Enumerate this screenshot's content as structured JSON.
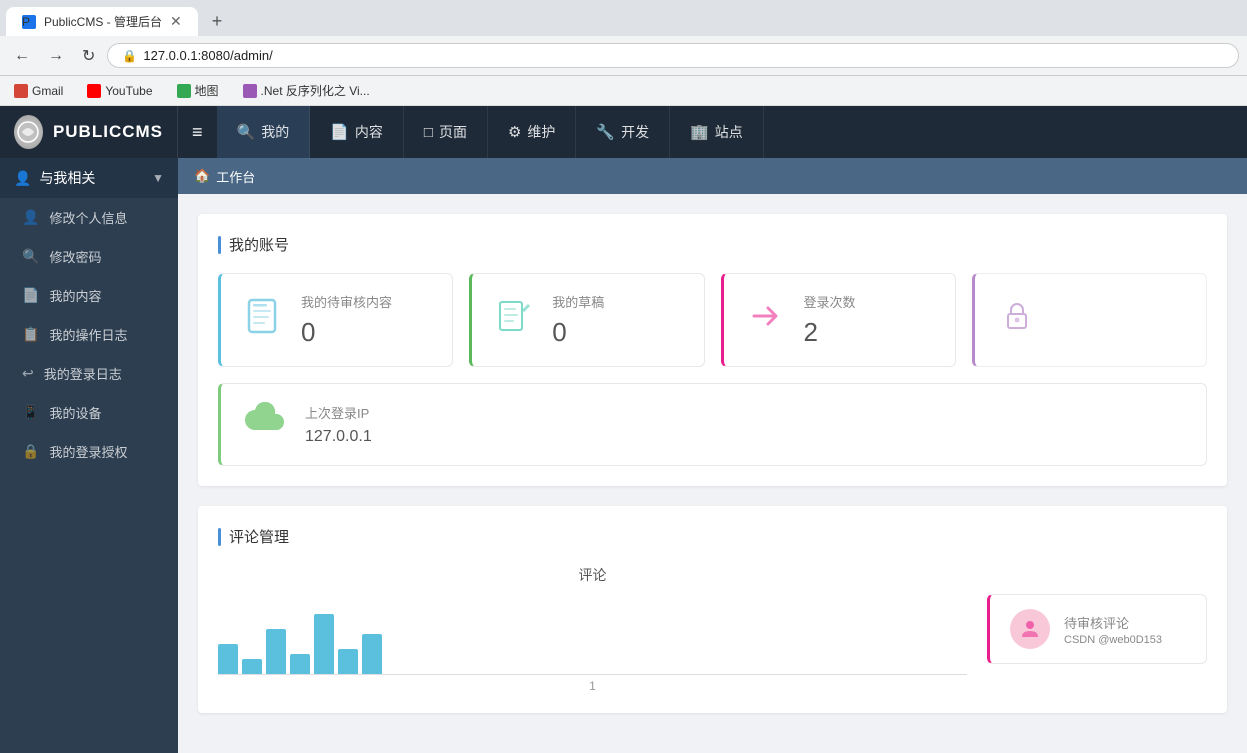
{
  "browser": {
    "tab": {
      "title": "PublicCMS - 管理后台",
      "favicon": "P"
    },
    "address": "127.0.0.1:8080/admin/",
    "protocol_icon": "🔒",
    "new_tab_label": "+",
    "bookmarks": [
      {
        "id": "gmail",
        "label": "Gmail",
        "favicon_class": "gmail-favicon"
      },
      {
        "id": "youtube",
        "label": "YouTube",
        "favicon_class": "youtube-favicon"
      },
      {
        "id": "maps",
        "label": "地图",
        "favicon_class": "maps-favicon"
      },
      {
        "id": "dotnet",
        "label": ".Net 反序列化之 Vi...",
        "favicon_class": "dotnet-favicon"
      }
    ],
    "nav_back": "←",
    "nav_forward": "→",
    "nav_refresh": "↻"
  },
  "app": {
    "logo_text": "PUBLICCMS",
    "hamburger": "≡",
    "nav_items": [
      {
        "id": "mine",
        "label": "我的",
        "icon": "🔍"
      },
      {
        "id": "content",
        "label": "内容",
        "icon": "📄"
      },
      {
        "id": "page",
        "label": "页面",
        "icon": "□"
      },
      {
        "id": "maintain",
        "label": "维护",
        "icon": "⚙"
      },
      {
        "id": "develop",
        "label": "开发",
        "icon": "🔧"
      },
      {
        "id": "site",
        "label": "站点",
        "icon": "🏢"
      }
    ],
    "sidebar_header": "与我相关",
    "sidebar_items": [
      {
        "id": "edit-profile",
        "label": "修改个人信息",
        "icon": "👤"
      },
      {
        "id": "change-password",
        "label": "修改密码",
        "icon": "🔍"
      },
      {
        "id": "my-content",
        "label": "我的内容",
        "icon": "📄"
      },
      {
        "id": "my-oplog",
        "label": "我的操作日志",
        "icon": "📋"
      },
      {
        "id": "my-login-log",
        "label": "我的登录日志",
        "icon": "↩"
      },
      {
        "id": "my-device",
        "label": "我的设备",
        "icon": "📱"
      },
      {
        "id": "my-auth",
        "label": "我的登录授权",
        "icon": "🔒"
      }
    ],
    "breadcrumb": {
      "icon": "🏠",
      "label": "工作台"
    },
    "sections": {
      "account": {
        "title": "我的账号",
        "cards": [
          {
            "id": "pending-review",
            "label": "我的待审核内容",
            "value": "0",
            "icon": "📘",
            "color_class": "card-blue",
            "icon_class": "card-icon-blue"
          },
          {
            "id": "draft",
            "label": "我的草稿",
            "value": "0",
            "icon": "✏",
            "color_class": "card-teal",
            "icon_class": "card-icon-teal"
          },
          {
            "id": "login-count",
            "label": "登录次数",
            "value": "2",
            "icon": "➡",
            "color_class": "card-pink",
            "icon_class": "card-icon-pink"
          },
          {
            "id": "locked",
            "label": "",
            "value": "",
            "icon": "🔒",
            "color_class": "card-purple",
            "icon_class": "card-icon-purple"
          }
        ],
        "ip_card": {
          "label": "上次登录IP",
          "value": "127.0.0.1",
          "icon": "☁"
        }
      },
      "comments": {
        "title": "评论管理",
        "chart_title": "评论",
        "chart_value_label": "1",
        "pending_card": {
          "label": "待审核评论",
          "value": "",
          "csdn_badge": "CSDN @web0D153"
        }
      }
    }
  }
}
